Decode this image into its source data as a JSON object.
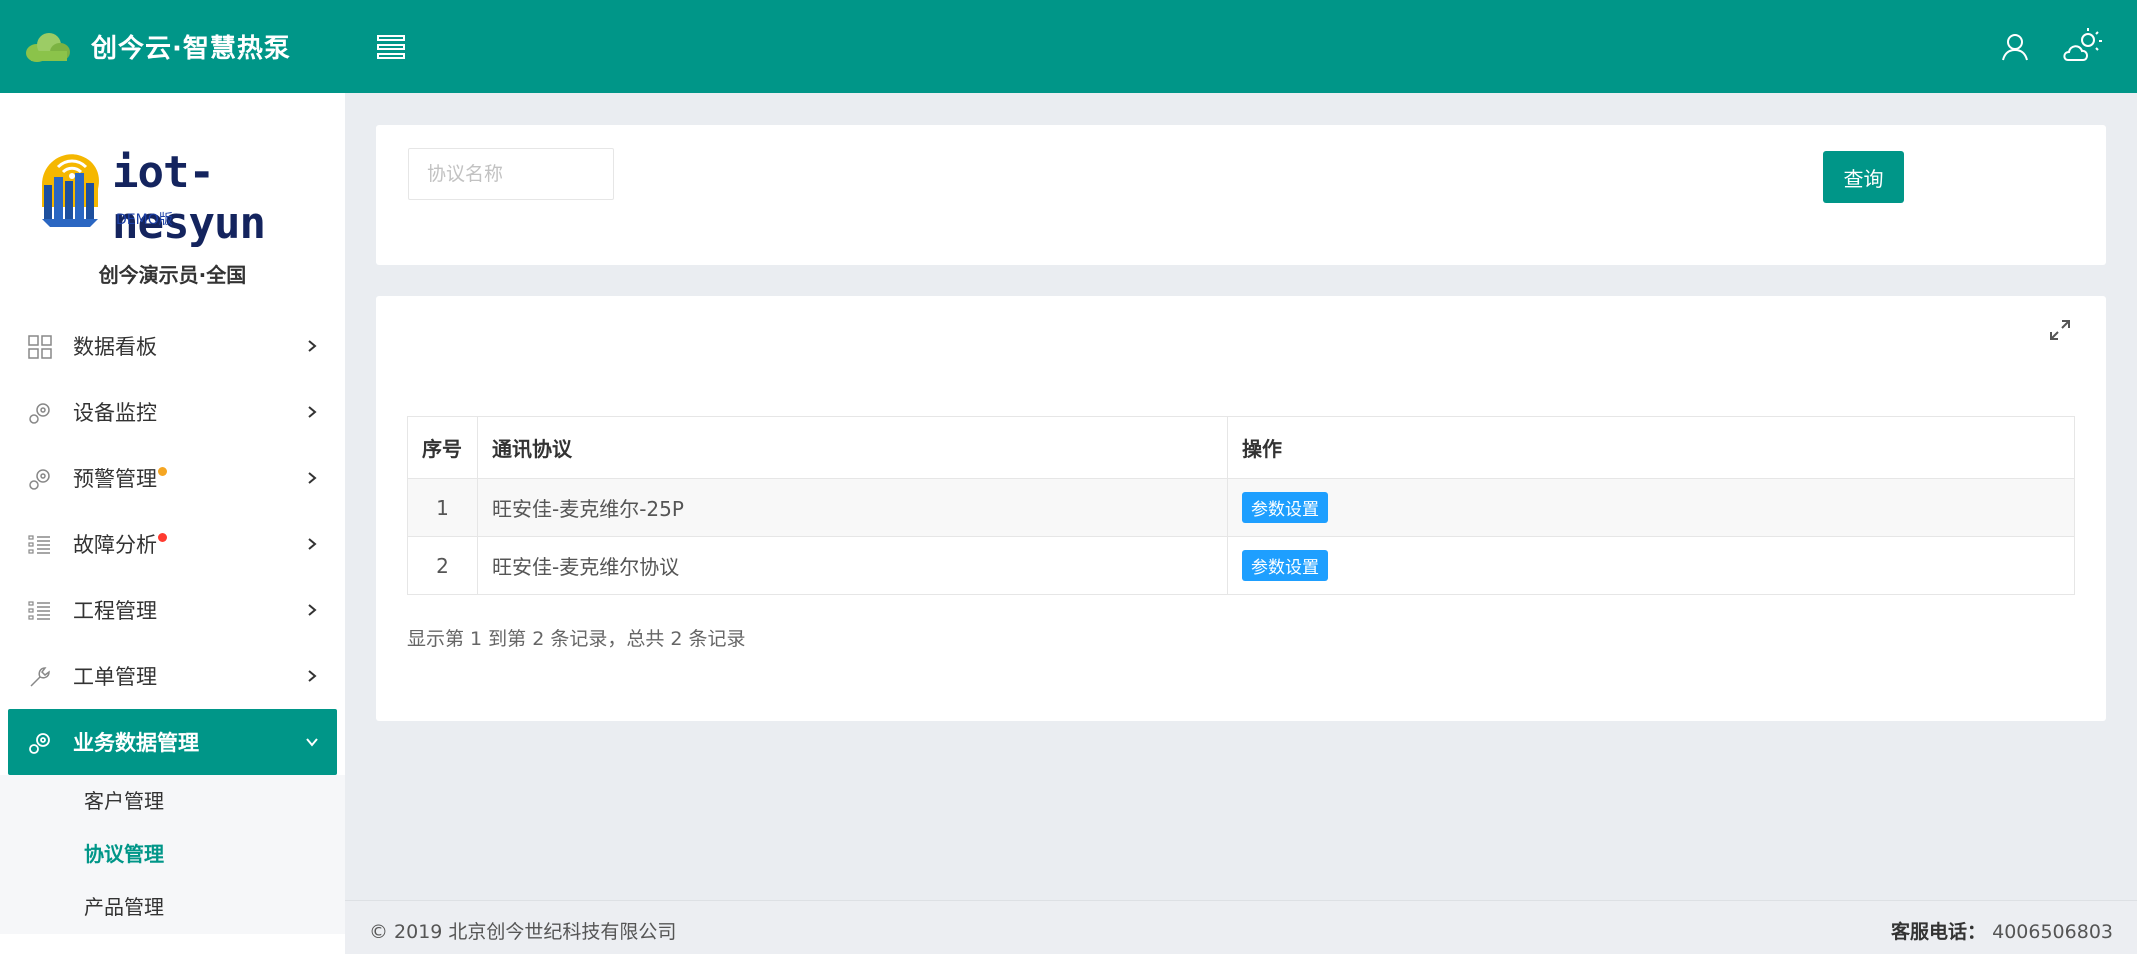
{
  "topbar": {
    "title": "创今云·智慧热泵",
    "brand_color": "#009688"
  },
  "sidebar": {
    "logo_text": "iot-nesyun",
    "logo_demo": "DEMO版",
    "user": "创今演示员·全国",
    "items": [
      {
        "label": "数据看板",
        "icon": "grid-icon"
      },
      {
        "label": "设备监控",
        "icon": "gears-icon"
      },
      {
        "label": "预警管理",
        "icon": "gears-icon",
        "dot": "#f5a623"
      },
      {
        "label": "故障分析",
        "icon": "list-icon",
        "dot": "#ff3b30"
      },
      {
        "label": "工程管理",
        "icon": "list-icon"
      },
      {
        "label": "工单管理",
        "icon": "wrench-icon"
      },
      {
        "label": "业务数据管理",
        "icon": "gears-icon",
        "active": true
      }
    ],
    "subitems": [
      {
        "label": "客户管理"
      },
      {
        "label": "协议管理",
        "current": true
      },
      {
        "label": "产品管理"
      }
    ]
  },
  "search": {
    "placeholder": "协议名称",
    "value": "",
    "button_label": "查询"
  },
  "table": {
    "headers": [
      "序号",
      "通讯协议",
      "操作"
    ],
    "rows": [
      {
        "index": "1",
        "protocol": "旺安佳-麦克维尔-25P",
        "action": "参数设置"
      },
      {
        "index": "2",
        "protocol": "旺安佳-麦克维尔协议",
        "action": "参数设置"
      }
    ],
    "summary": "显示第 1 到第 2 条记录，总共 2 条记录"
  },
  "footer": {
    "copyright": "© 2019 北京创今世纪科技有限公司",
    "hotline_label": "客服电话：",
    "hotline_number": "4006506803"
  }
}
